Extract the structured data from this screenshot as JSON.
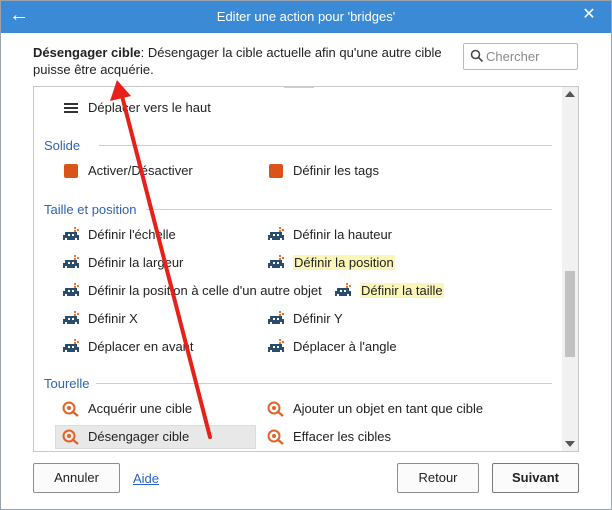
{
  "window": {
    "title": "Editer une action pour 'bridges'",
    "back_icon": "arrow-left-icon",
    "close_icon": "close-icon"
  },
  "description": {
    "name": "Désengager cible",
    "text": ": Désengager la cible actuelle afin qu'une autre cible puisse être acquérie."
  },
  "search": {
    "placeholder": "Chercher",
    "value": ""
  },
  "list": {
    "top_item": {
      "label": "Déplacer vers le haut",
      "icon": "lines-icon"
    },
    "categories": [
      {
        "name": "Solide",
        "items": [
          {
            "label": "Activer/Désactiver",
            "icon": "solid-square-icon"
          },
          {
            "label": "Définir les tags",
            "icon": "solid-square-icon"
          }
        ]
      },
      {
        "name": "Taille et position",
        "items": [
          {
            "label": "Définir l'échelle",
            "icon": "sprite-icon"
          },
          {
            "label": "Définir la hauteur",
            "icon": "sprite-icon"
          },
          {
            "label": "Définir la largeur",
            "icon": "sprite-icon"
          },
          {
            "label": "Définir la position",
            "icon": "sprite-icon",
            "highlighted": true
          },
          {
            "label": "Définir la position à celle d'un autre objet",
            "icon": "sprite-icon"
          },
          {
            "label": "Définir la taille",
            "icon": "sprite-icon",
            "highlighted": true
          },
          {
            "label": "Définir X",
            "icon": "sprite-icon"
          },
          {
            "label": "Définir Y",
            "icon": "sprite-icon"
          },
          {
            "label": "Déplacer en avant",
            "icon": "sprite-icon"
          },
          {
            "label": "Déplacer à l'angle",
            "icon": "sprite-icon"
          }
        ]
      },
      {
        "name": "Tourelle",
        "items": [
          {
            "label": "Acquérir une cible",
            "icon": "turret-target-icon"
          },
          {
            "label": "Ajouter un objet en tant que cible",
            "icon": "turret-target-icon"
          },
          {
            "label": "Désengager cible",
            "icon": "turret-target-icon",
            "selected": true
          },
          {
            "label": "Effacer les cibles",
            "icon": "turret-target-icon"
          }
        ]
      }
    ]
  },
  "footer": {
    "cancel_label": "Annuler",
    "help_label": "Aide",
    "back_label": "Retour",
    "next_label": "Suivant"
  },
  "colors": {
    "titlebar": "#3a8ad6",
    "category": "#2d63b0",
    "solid_icon": "#d9541a",
    "sprite_icon": "#2a4d6e",
    "turret_icon": "#e0642a",
    "highlight": "#fbf6b8",
    "annotation_arrow": "#e8201a"
  }
}
